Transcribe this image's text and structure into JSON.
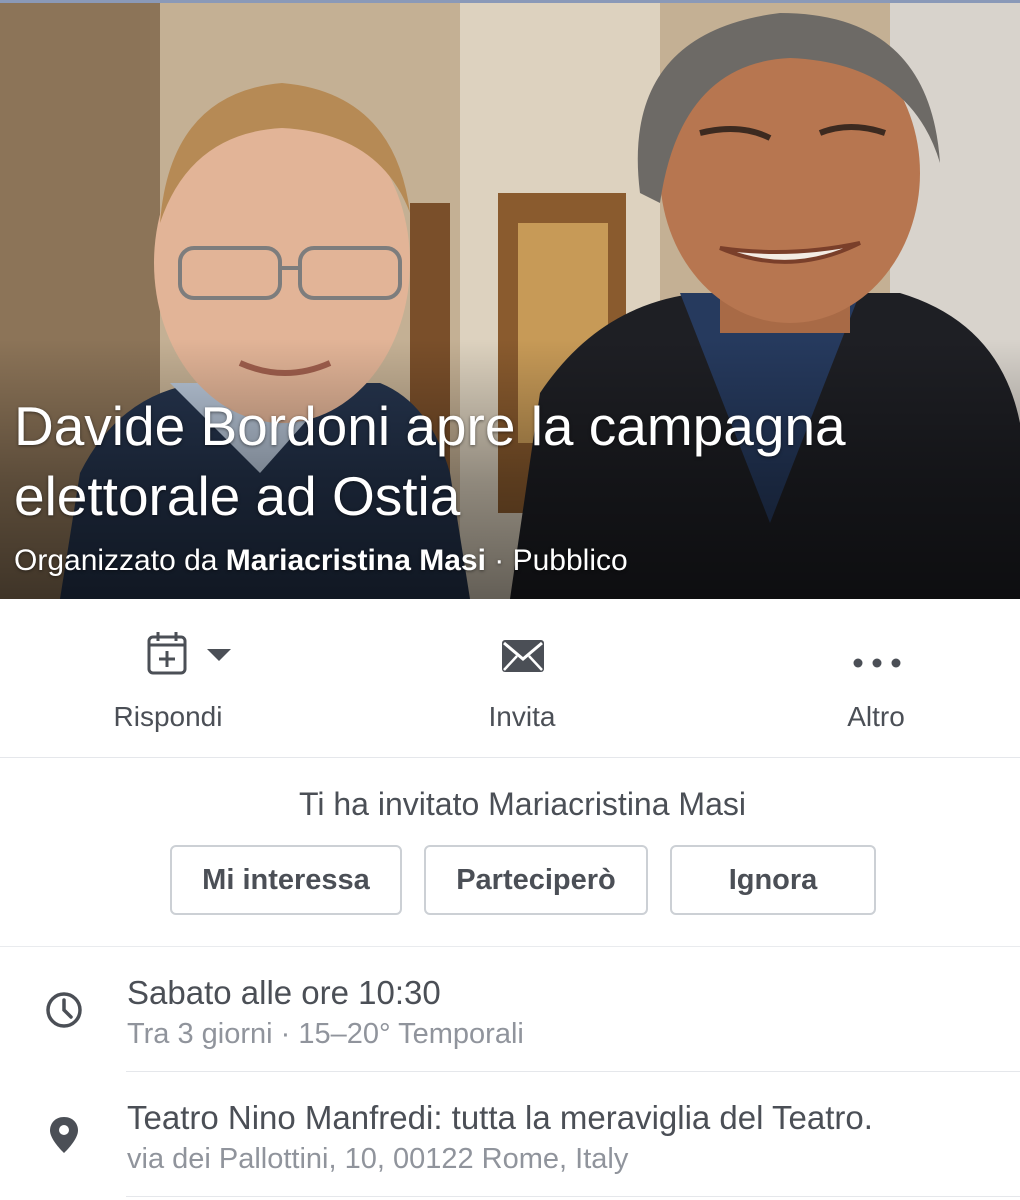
{
  "colors": {
    "primary_text": "#4b4f56",
    "secondary_text": "#90949c",
    "button_border": "#ccd0d5",
    "divider": "#e5e7eb"
  },
  "cover": {
    "title": "Davide Bordoni apre la campagna elettorale ad Ostia",
    "organizer_prefix": "Organizzato da",
    "organizer_name": "Mariacristina Masi",
    "separator": "·",
    "privacy": "Pubblico"
  },
  "actions": {
    "respond": {
      "label": "Rispondi",
      "icon": "calendar-add-icon"
    },
    "invite": {
      "label": "Invita",
      "icon": "envelope-icon"
    },
    "more": {
      "label": "Altro",
      "icon": "more-dots-icon"
    }
  },
  "invitation": {
    "text": "Ti ha invitato Mariacristina Masi",
    "buttons": {
      "interested": "Mi interessa",
      "going": "Parteciperò",
      "ignore": "Ignora"
    }
  },
  "details": {
    "time": {
      "icon": "clock-icon",
      "primary": "Sabato alle ore 10:30",
      "secondary": "Tra 3 giorni · 15–20° Temporali"
    },
    "place": {
      "icon": "location-pin-icon",
      "primary": "Teatro Nino Manfredi: tutta la meraviglia del Teatro.",
      "secondary": "via dei Pallottini, 10, 00122 Rome, Italy"
    }
  }
}
